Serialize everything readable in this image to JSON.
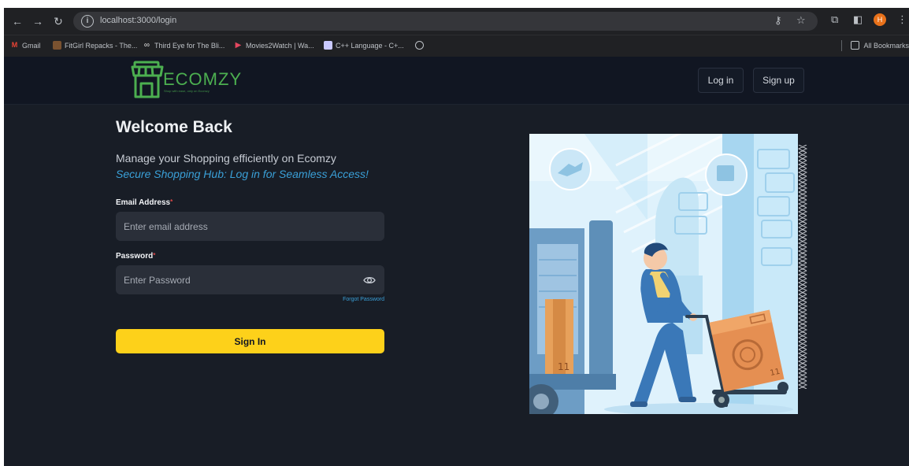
{
  "browser": {
    "url": "localhost:3000/login",
    "bookmarks": [
      {
        "label": "Gmail"
      },
      {
        "label": "FitGirl Repacks - The..."
      },
      {
        "label": "Third Eye for The Bli..."
      },
      {
        "label": "Movies2Watch | Wa..."
      },
      {
        "label": "C++ Language - C+..."
      }
    ],
    "all_bookmarks": "All Bookmarks",
    "profile_initial": "H"
  },
  "header": {
    "brand": "ECOMZY",
    "tagline": "Shop with ease, only on Ecomzy",
    "login_label": "Log in",
    "signup_label": "Sign up"
  },
  "login": {
    "title": "Welcome Back",
    "subtitle": "Manage your Shopping efficiently on Ecomzy",
    "tagline": "Secure Shopping Hub: Log in for Seamless Access!",
    "email_label": "Email Address",
    "email_placeholder": "Enter email address",
    "password_label": "Password",
    "password_placeholder": "Enter Password",
    "forgot_label": "Forgot Password",
    "signin_label": "Sign In",
    "required_mark": "*"
  },
  "colors": {
    "accent": "#fdd11a",
    "link": "#3aa0d8",
    "brand_green": "#4caf50",
    "page_bg": "#181d26"
  }
}
